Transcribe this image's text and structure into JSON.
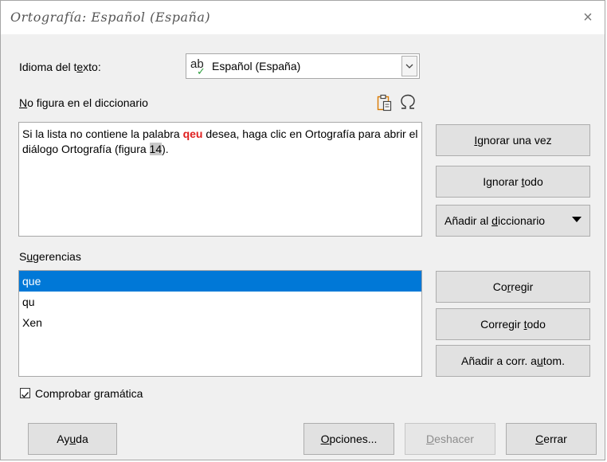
{
  "window": {
    "title": "Ortografía: Español (España)",
    "close_glyph": "×"
  },
  "language": {
    "label_pre": "Idioma del t",
    "label_ul": "e",
    "label_post": "xto:",
    "value": "Español (España)"
  },
  "not_in_dict": {
    "label_ul": "N",
    "label_post": "o figura en el diccionario",
    "text_pre": "Si la lista no contiene la palabra ",
    "text_error": "qeu",
    "text_mid": " desea, haga clic en Ortografía para abrir el diálogo Ortografía (figura ",
    "text_hl": "14",
    "text_post": ")."
  },
  "suggestions": {
    "label_pre": "S",
    "label_ul": "u",
    "label_post": "gerencias",
    "items": [
      "que",
      "qu",
      "Xen"
    ]
  },
  "grammar": {
    "label_pre": "Comprobar ",
    "label_ul": "g",
    "label_post": "ramática",
    "checked": true
  },
  "buttons": {
    "ignore_once": {
      "pre": "",
      "ul": "I",
      "post": "gnorar una vez"
    },
    "ignore_all": {
      "pre": "Ignorar ",
      "ul": "t",
      "post": "odo"
    },
    "add_dict": {
      "pre": "Añadir al ",
      "ul": "d",
      "post": "iccionario"
    },
    "correct": {
      "pre": "Co",
      "ul": "r",
      "post": "regir"
    },
    "correct_all": {
      "pre": "Corregir ",
      "ul": "t",
      "post": "odo"
    },
    "autocorrect": {
      "pre": "Añadir a corr. a",
      "ul": "u",
      "post": "tom."
    },
    "help": {
      "pre": "Ay",
      "ul": "u",
      "post": "da"
    },
    "options": {
      "pre": "",
      "ul": "O",
      "post": "pciones..."
    },
    "undo": {
      "pre": "",
      "ul": "D",
      "post": "eshacer"
    },
    "close": {
      "pre": "",
      "ul": "C",
      "post": "errar"
    }
  },
  "colors": {
    "selection": "#0078d7",
    "error_word": "#e02020",
    "button_face": "#e1e1e1",
    "dialog_bg": "#f0f0f0"
  },
  "icons": {
    "paste": "paste-icon",
    "special_char": "omega-icon",
    "spellcheck": "spellcheck-icon",
    "dropdown": "chevron-down-icon"
  }
}
